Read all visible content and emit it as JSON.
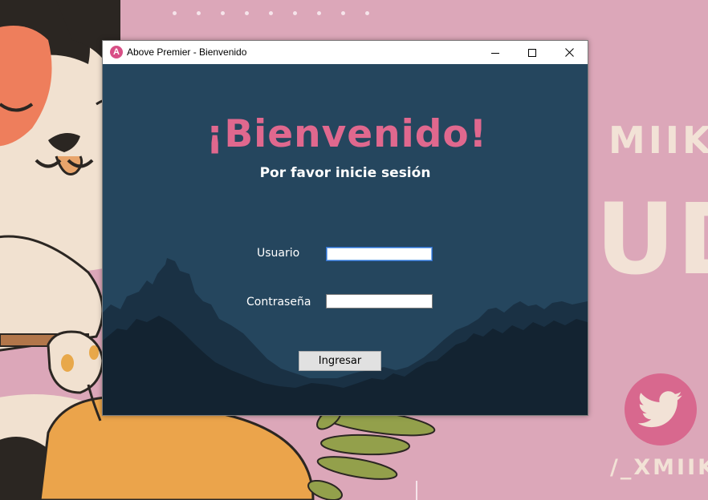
{
  "wallpaper": {
    "text_top": "MIIKU",
    "text_big": "UD",
    "handle": "/_XMIIKU",
    "twitter_icon": "twitter-bird-icon",
    "background_color": "#dca7b9"
  },
  "window": {
    "title": "Above Premier - Bienvenido",
    "app_icon_letter": "A",
    "controls": {
      "minimize": "minimize-icon",
      "maximize": "maximize-icon",
      "close": "close-icon"
    }
  },
  "login": {
    "heading": "¡Bienvenido!",
    "subheading": "Por favor inicie sesión",
    "user_label": "Usuario",
    "user_value": "",
    "password_label": "Contraseña",
    "password_value": "",
    "submit_label": "Ingresar"
  },
  "colors": {
    "panel_bg": "#25465e",
    "accent_pink": "#e0688e",
    "mountain_dark": "#132331"
  }
}
